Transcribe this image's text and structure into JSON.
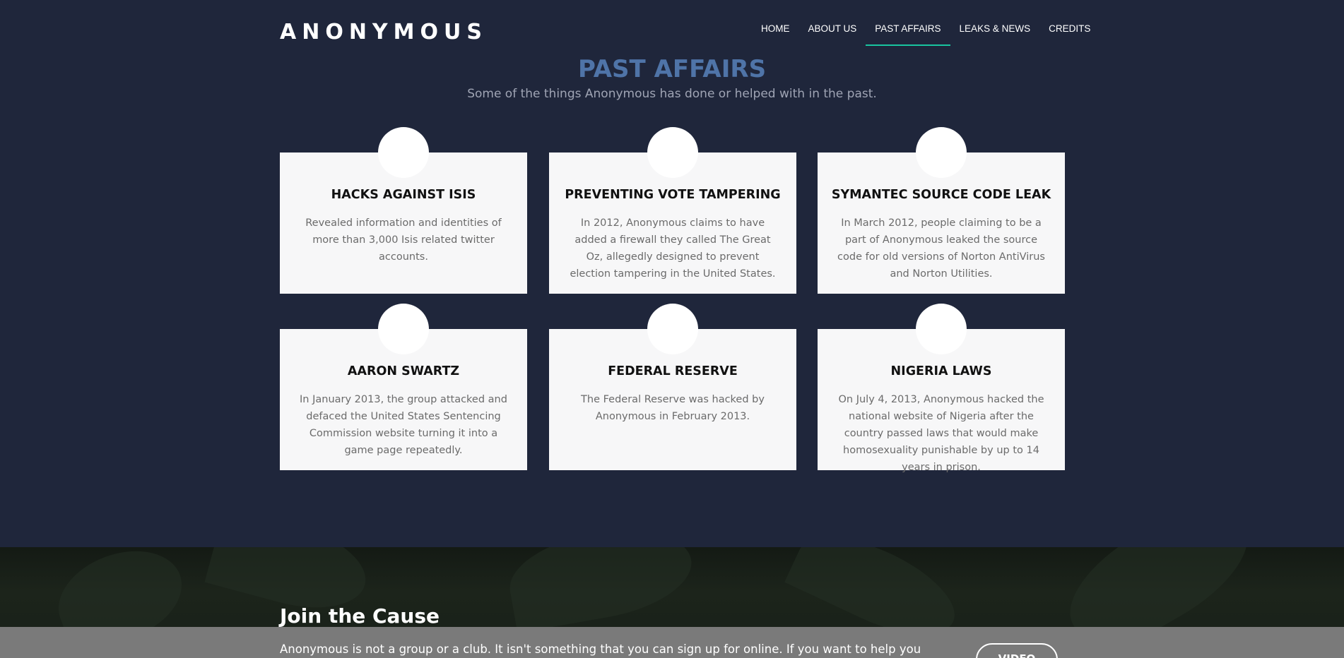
{
  "header": {
    "logo": "ANONYMOUS",
    "nav": [
      {
        "label": "HOME",
        "active": false
      },
      {
        "label": "ABOUT US",
        "active": false
      },
      {
        "label": "PAST AFFAIRS",
        "active": true
      },
      {
        "label": "LEAKS & NEWS",
        "active": false
      },
      {
        "label": "CREDITS",
        "active": false
      }
    ]
  },
  "section": {
    "title": "PAST AFFAIRS",
    "subtitle": "Some of the things Anonymous has done or helped with in the past."
  },
  "cards": [
    {
      "title": "HACKS AGAINST ISIS",
      "text": "Revealed information and identities of more than 3,000 Isis related twitter accounts."
    },
    {
      "title": "PREVENTING VOTE TAMPERING",
      "text": "In 2012, Anonymous claims to have added a firewall they called The Great Oz, allegedly designed to prevent election tampering in the United States."
    },
    {
      "title": "SYMANTEC SOURCE CODE LEAK",
      "text": "In March 2012, people claiming to be a part of Anonymous leaked the source code for old versions of Norton AntiVirus and Norton Utilities."
    },
    {
      "title": "AARON SWARTZ",
      "text": "In January 2013, the group attacked and defaced the United States Sentencing Commission website turning it into a game page repeatedly."
    },
    {
      "title": "FEDERAL RESERVE",
      "text": "The Federal Reserve was hacked by Anonymous in February 2013."
    },
    {
      "title": "NIGERIA LAWS",
      "text": "On July 4, 2013, Anonymous hacked the national website of Nigeria after the country passed laws that would make homosexuality punishable by up to 14 years in prison."
    }
  ],
  "join": {
    "title": "Join the Cause",
    "text": "Anonymous is not a group or a club. It isn't something that you can sign up for online. If you want to help you",
    "button_label": "VIDEO"
  },
  "colors": {
    "background": "#1f263b",
    "title_accent": "#4f74a8",
    "nav_underline": "#19c4a0",
    "card_bg": "#f7f7f8"
  }
}
